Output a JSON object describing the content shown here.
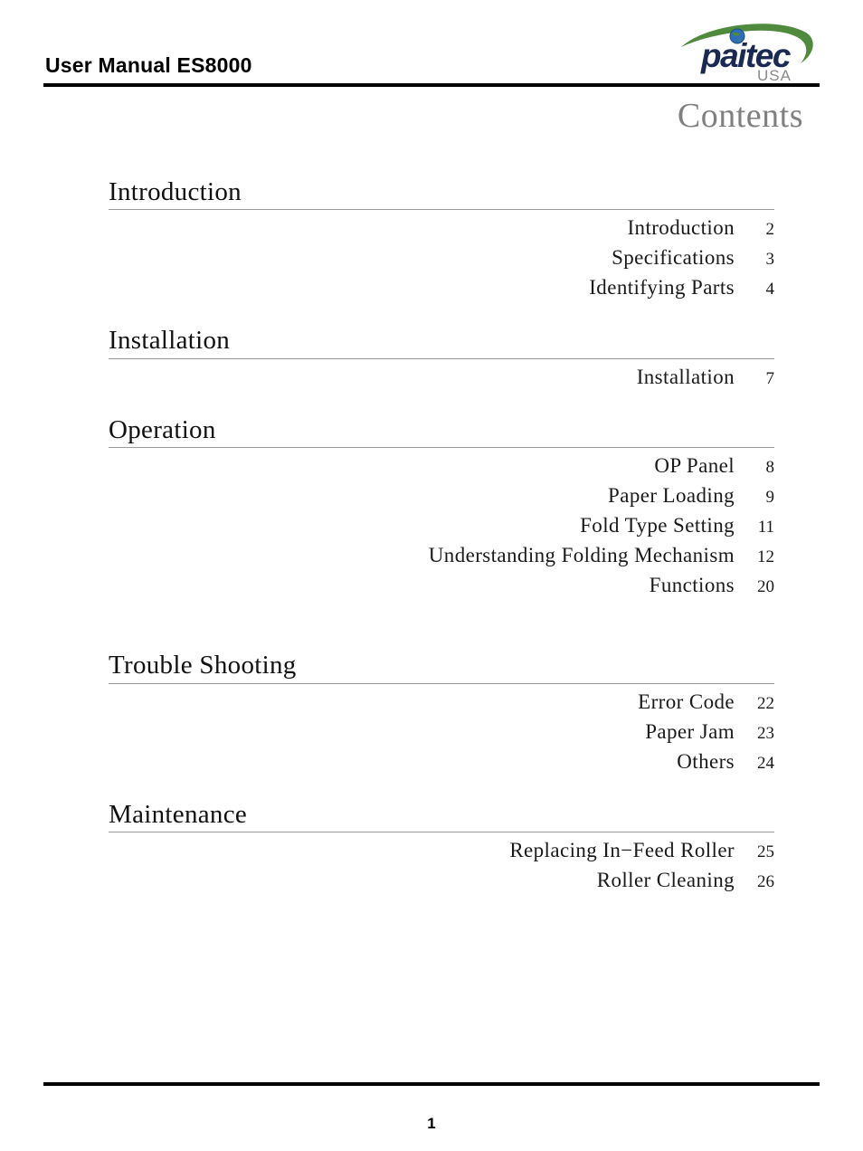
{
  "header": {
    "doc_title": "User Manual ES8000",
    "logo": {
      "wordmark": "paitec",
      "sub": "USA",
      "wordmark_color": "#1b2a52",
      "sub_color": "#8a8a8a",
      "swoosh_color": "#4f8a3d",
      "globe_color": "#2e6fb7"
    }
  },
  "contents": {
    "title": "Contents"
  },
  "toc": {
    "sections": [
      {
        "heading": "Introduction",
        "entries": [
          {
            "label": "Introduction",
            "page": "2"
          },
          {
            "label": "Specifications",
            "page": "3"
          },
          {
            "label": "Identifying Parts",
            "page": "4"
          }
        ]
      },
      {
        "heading": "Installation",
        "entries": [
          {
            "label": "Installation",
            "page": "7"
          }
        ]
      },
      {
        "heading": "Operation",
        "entries": [
          {
            "label": "OP Panel",
            "page": "8"
          },
          {
            "label": "Paper Loading",
            "page": "9"
          },
          {
            "label": "Fold Type Setting",
            "page": "11"
          },
          {
            "label": "Understanding Folding Mechanism",
            "page": "12"
          },
          {
            "label": "Functions",
            "page": "20"
          }
        ]
      },
      {
        "heading": "Trouble Shooting",
        "entries": [
          {
            "label": "Error Code",
            "page": "22"
          },
          {
            "label": "Paper Jam",
            "page": "23"
          },
          {
            "label": "Others",
            "page": "24"
          }
        ]
      },
      {
        "heading": "Maintenance",
        "entries": [
          {
            "label": "Replacing In−Feed Roller",
            "page": "25"
          },
          {
            "label": "Roller Cleaning",
            "page": "26"
          }
        ]
      }
    ]
  },
  "footer": {
    "page_number": "1"
  }
}
